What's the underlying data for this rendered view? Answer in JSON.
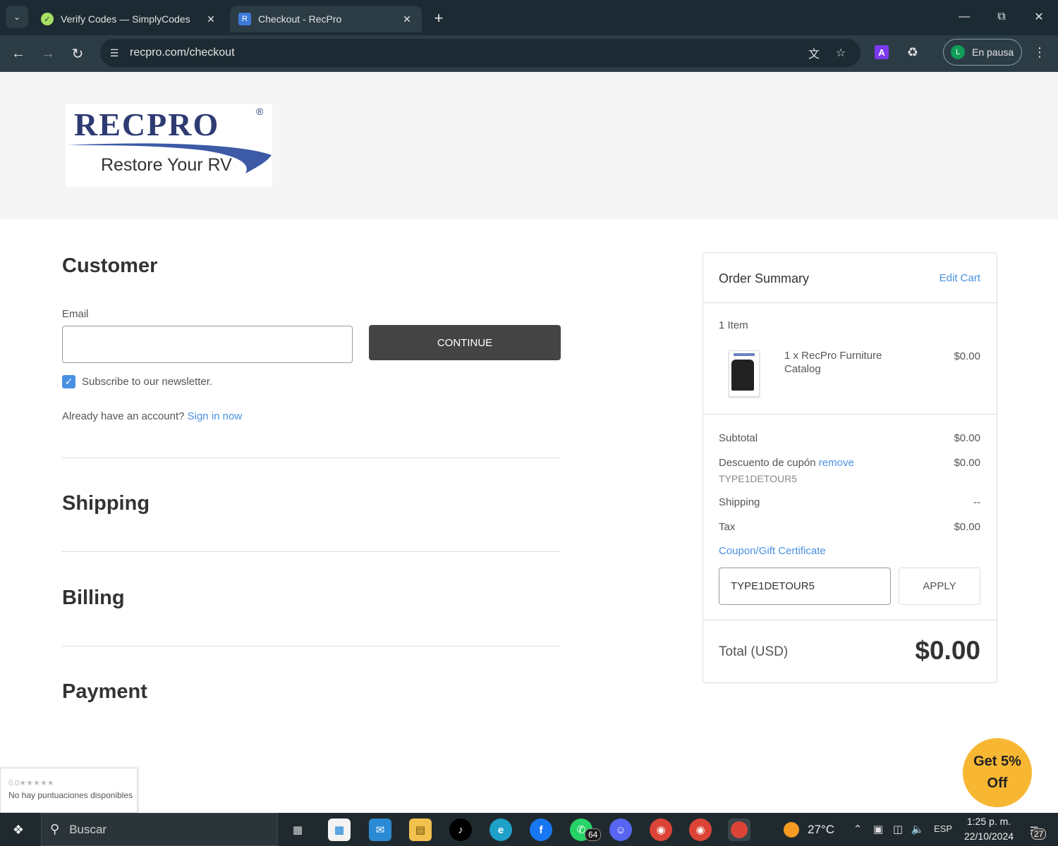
{
  "browser": {
    "tabs": [
      {
        "title": "Verify Codes — SimplyCodes",
        "favicon": "simplycodes-check-icon",
        "active": false
      },
      {
        "title": "Checkout - RecPro",
        "favicon": "recpro-icon",
        "active": true
      }
    ],
    "url": "recpro.com/checkout",
    "profile_initial": "L",
    "profile_label": "En pausa",
    "extension_letter": "A"
  },
  "header": {
    "logo_text": "RECPRO",
    "logo_mark": "®",
    "logo_tagline": "Restore Your RV"
  },
  "customer": {
    "title": "Customer",
    "email_label": "Email",
    "email_value": "",
    "continue_label": "CONTINUE",
    "newsletter_label": "Subscribe to our newsletter.",
    "newsletter_checked": true,
    "account_prompt": "Already have an account?",
    "sign_in_label": "Sign in now"
  },
  "sections": {
    "shipping": "Shipping",
    "billing": "Billing",
    "payment": "Payment"
  },
  "order_summary": {
    "title": "Order Summary",
    "edit_cart": "Edit Cart",
    "item_count": "1 Item",
    "items": [
      {
        "name": "1 x RecPro Furniture Catalog",
        "price": "$0.00"
      }
    ],
    "subtotal_label": "Subtotal",
    "subtotal_value": "$0.00",
    "discount_label": "Descuento de cupón",
    "discount_remove": "remove",
    "discount_value": "$0.00",
    "coupon_code": "TYPE1DETOUR5",
    "shipping_label": "Shipping",
    "shipping_value": "--",
    "tax_label": "Tax",
    "tax_value": "$0.00",
    "coupon_link": "Coupon/Gift Certificate",
    "coupon_input_value": "TYPE1DETOUR5",
    "apply_label": "APPLY",
    "total_label": "Total (USD)",
    "total_value": "$0.00"
  },
  "widgets": {
    "ratings_score": "0.0★★★★★",
    "ratings_text": "No hay puntuaciones disponibles",
    "promo_line1": "Get 5%",
    "promo_line2": "Off"
  },
  "taskbar": {
    "search_label": "Buscar",
    "whatsapp_badge": "64",
    "weather_temp": "27°C",
    "language": "ESP",
    "time": "1:25 p. m.",
    "date": "22/10/2024",
    "notification_count": "27"
  },
  "colors": {
    "chrome_dark": "#1c2b33",
    "link_blue": "#4a90e2",
    "continue_bg": "#444444",
    "promo_yellow": "#f7b733",
    "logo_navy": "#2e3b73"
  }
}
